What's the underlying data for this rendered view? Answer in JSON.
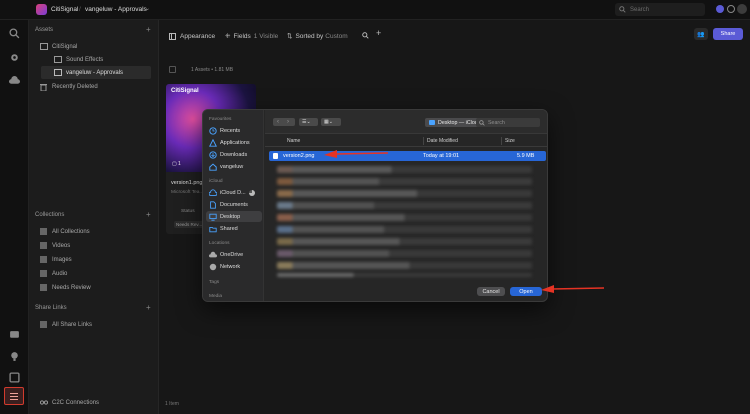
{
  "topbar": {
    "app_name": "CitiSignal",
    "breadcrumb_sep": "/",
    "project": "vangeluw - Approvals",
    "search_placeholder": "Search"
  },
  "sidebar": {
    "assets_header": "Assets",
    "items": [
      {
        "label": "CitiSignal"
      },
      {
        "label": "Sound Effects"
      },
      {
        "label": "vangeluw - Approvals"
      },
      {
        "label": "Recently Deleted"
      }
    ],
    "collections_header": "Collections",
    "collections": [
      {
        "label": "All Collections"
      },
      {
        "label": "Videos"
      },
      {
        "label": "Images"
      },
      {
        "label": "Audio"
      },
      {
        "label": "Needs Review"
      }
    ],
    "share_header": "Share Links",
    "share_items": [
      {
        "label": "All Share Links"
      }
    ],
    "footer_link": "C2C Connections"
  },
  "main": {
    "toolbar": {
      "appearance": "Appearance",
      "fields": "Fields",
      "fields_count": "1 Visible",
      "sorted_prefix": "Sorted by",
      "sorted_value": "Custom",
      "share_label": "Share"
    },
    "summary": "1 Assets • 1.81 MB",
    "card": {
      "brand": "CitiSignal",
      "count": "1",
      "filename": "version1.png",
      "uploader": "Microsoft Tea...",
      "status": "Status",
      "badge": "Needs Rev..."
    },
    "footer_count": "1 Item"
  },
  "dialog": {
    "favorites_header": "Favourites",
    "favorites": [
      {
        "label": "Recents",
        "icon": "clock-icon"
      },
      {
        "label": "Applications",
        "icon": "apps-icon"
      },
      {
        "label": "Downloads",
        "icon": "download-icon"
      },
      {
        "label": "vangeluw",
        "icon": "home-icon"
      }
    ],
    "icloud_header": "iCloud",
    "icloud": [
      {
        "label": "iCloud D...",
        "icon": "cloud-icon"
      },
      {
        "label": "Documents",
        "icon": "doc-icon"
      },
      {
        "label": "Desktop",
        "icon": "desktop-icon"
      },
      {
        "label": "Shared",
        "icon": "folder-icon"
      }
    ],
    "locations_header": "Locations",
    "locations": [
      {
        "label": "OneDrive",
        "icon": "cloud-icon"
      },
      {
        "label": "Network",
        "icon": "globe-icon"
      }
    ],
    "tags_header": "Tags",
    "media_header": "Media",
    "path": "Desktop — iCloud",
    "search_placeholder": "Search",
    "columns": {
      "name": "Name",
      "date": "Date Modified",
      "size": "Size"
    },
    "selected_file": {
      "name": "version2.png",
      "date": "Today at 19:01",
      "size": "5.9 MB"
    },
    "cancel_label": "Cancel",
    "open_label": "Open"
  },
  "colors": {
    "accent": "#2766d6",
    "annotation": "#e53324",
    "share_button": "#5b5bd6"
  }
}
